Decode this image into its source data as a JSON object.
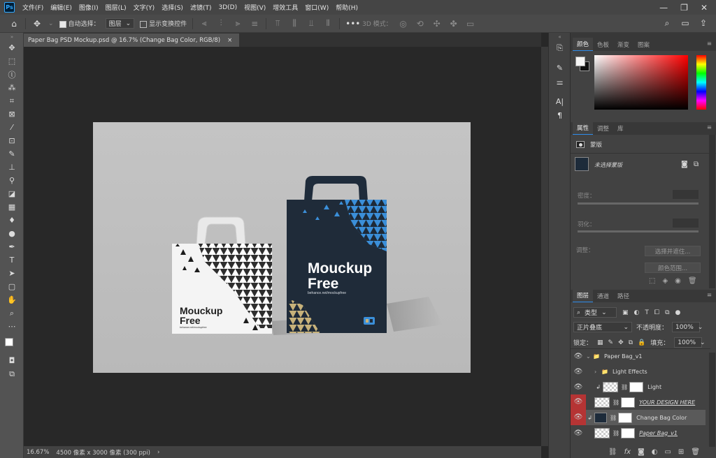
{
  "menubar": {
    "app_icon": "Ps",
    "items": [
      "文件(F)",
      "编辑(E)",
      "图像(I)",
      "图层(L)",
      "文字(Y)",
      "选择(S)",
      "滤镜(T)",
      "3D(D)",
      "视图(V)",
      "增效工具",
      "窗口(W)",
      "帮助(H)"
    ],
    "window_buttons": [
      "—",
      "❐",
      "✕"
    ]
  },
  "options": {
    "auto_select_label": "自动选择：",
    "auto_select_value": "图层",
    "show_transform_label": "显示变换控件",
    "mode_3d_label": "3D 模式："
  },
  "document": {
    "tab_title": "Paper Bag PSD Mockup.psd @ 16.7% (Change Bag Color, RGB/8)",
    "tab_close": "×"
  },
  "status": {
    "zoom": "16.67%",
    "doc_info": "4500 像素 x 3000 像素 (300 ppi)",
    "arrow": "›"
  },
  "mockup": {
    "bag_small_title": "Mouckup",
    "bag_small_title2": "Free",
    "bag_small_url": "behance.net/mockupfree",
    "bag_large_title": "Mouckup",
    "bag_large_title2": "Free",
    "bag_large_url": "behance.net/mockupfree"
  },
  "color_panel": {
    "tabs": [
      "颜色",
      "色板",
      "渐变",
      "图案"
    ],
    "menu": "≡",
    "fg_color": "#f5f5f5",
    "bg_color": "#111111"
  },
  "properties_panel": {
    "tabs": [
      "属性",
      "调整",
      "库"
    ],
    "menu": "≡",
    "section": "蒙版",
    "mask_label": "未选择蒙版",
    "density_label": "密度：",
    "feather_label": "羽化：",
    "adjust_label": "调整：",
    "select_mask_btn": "选择并遮住...",
    "color_range_btn": "颜色范围..."
  },
  "layers_panel": {
    "tabs": [
      "图层",
      "通道",
      "路径"
    ],
    "menu": "≡",
    "filter_label": "类型",
    "blend_mode": "正片叠底",
    "opacity_label": "不透明度：",
    "opacity_value": "100%",
    "lock_label": "锁定：",
    "fill_label": "填充：",
    "fill_value": "100%",
    "layers": [
      {
        "name": "Paper Bag_v1",
        "kind": "group"
      },
      {
        "name": "Light Effects",
        "kind": "group"
      },
      {
        "name": "Light",
        "kind": "layer"
      },
      {
        "name": "YOUR DESIGN HERE",
        "kind": "smart"
      },
      {
        "name": "Change Bag Color",
        "kind": "fill",
        "selected": true
      },
      {
        "name": "Paper Bag_v1",
        "kind": "smart"
      }
    ]
  }
}
